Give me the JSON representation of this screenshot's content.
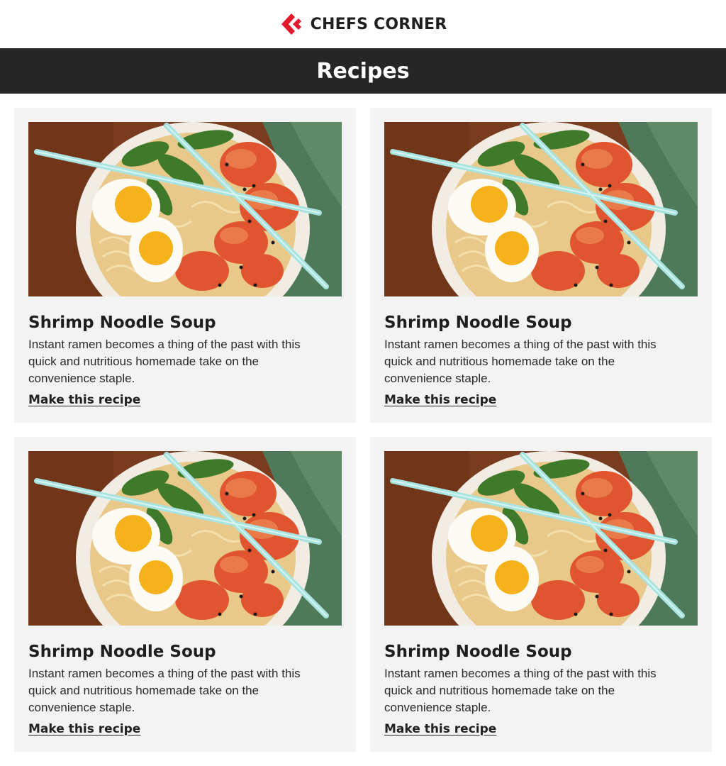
{
  "header": {
    "brand_name": "CHEFS CORNER",
    "logo_icon": "chevron-double-left-logo",
    "brand_color": "#e2192c"
  },
  "page": {
    "title": "Recipes",
    "title_bar_color": "#262626"
  },
  "cards": [
    {
      "title": "Shrimp Noodle Soup",
      "description": "Instant ramen becomes a thing of the past with this quick and nutritious homemade take on the convenience staple.",
      "link_label": "Make this recipe",
      "image": "ramen-bowl-photo"
    },
    {
      "title": "Shrimp Noodle Soup",
      "description": "Instant ramen becomes a thing of the past with this quick and nutritious homemade take on the convenience staple.",
      "link_label": "Make this recipe",
      "image": "ramen-bowl-photo"
    },
    {
      "title": "Shrimp Noodle Soup",
      "description": "Instant ramen becomes a thing of the past with this quick and nutritious homemade take on the convenience staple.",
      "link_label": "Make this recipe",
      "image": "ramen-bowl-photo"
    },
    {
      "title": "Shrimp Noodle Soup",
      "description": "Instant ramen becomes a thing of the past with this quick and nutritious homemade take on the convenience staple.",
      "link_label": "Make this recipe",
      "image": "ramen-bowl-photo"
    }
  ]
}
